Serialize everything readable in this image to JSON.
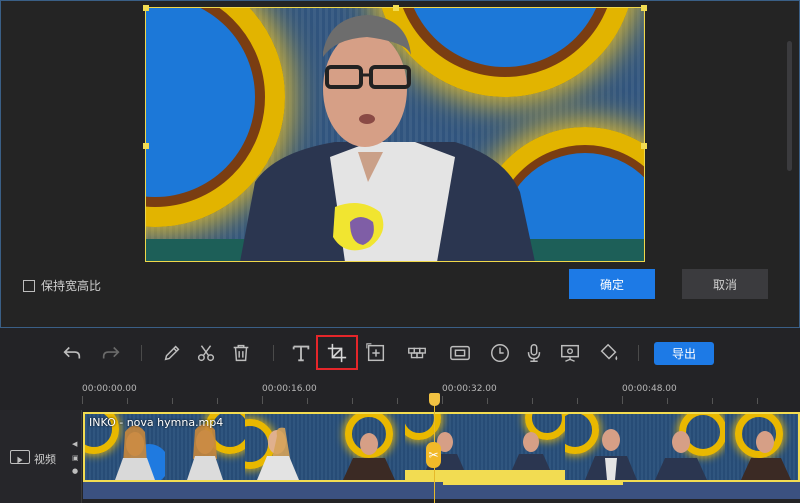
{
  "dialog": {
    "keep_ratio_label": "保持宽高比",
    "ok_label": "确定",
    "cancel_label": "取消"
  },
  "toolbar": {
    "icons": [
      "undo-icon",
      "redo-icon",
      "pencil-icon",
      "scissors-icon",
      "trash-icon",
      "text-icon",
      "crop-icon",
      "zoom-frame-icon",
      "mosaic-icon",
      "frame-icon",
      "clock-icon",
      "microphone-icon",
      "screen-record-icon",
      "paint-bucket-icon"
    ],
    "export_label": "导出"
  },
  "timeline": {
    "ticks": [
      "00:00:00.00",
      "00:00:16.00",
      "00:00:32.00",
      "00:00:48.00"
    ],
    "track_label": "视频",
    "clip_name": "INKO - nova hymna.mp4"
  },
  "colors": {
    "accent": "#1d7ae6",
    "highlight": "#e5262a",
    "playhead": "#f2c242",
    "crop_frame": "#f0d84a"
  }
}
